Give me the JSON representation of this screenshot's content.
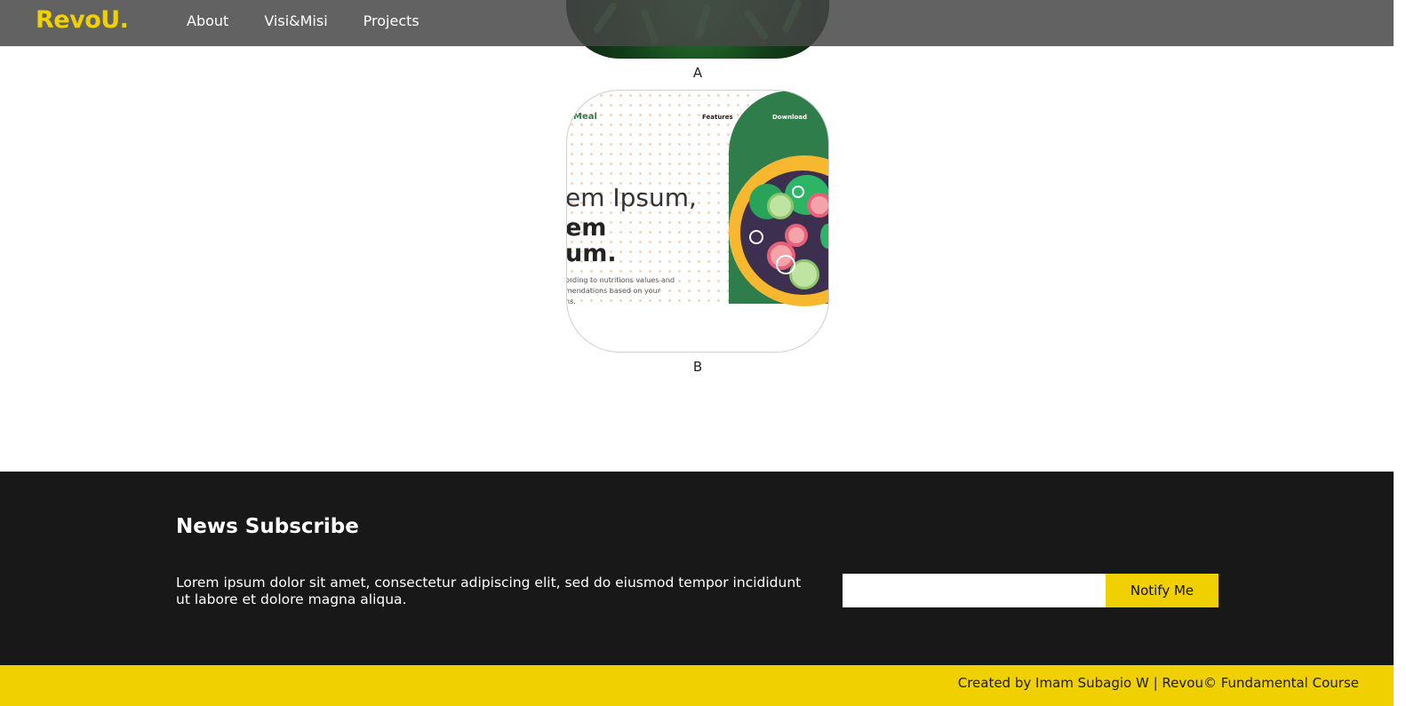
{
  "nav": {
    "brand": "RevoU.",
    "links": [
      {
        "label": "About"
      },
      {
        "label": "Visi&Misi"
      },
      {
        "label": "Projects"
      }
    ]
  },
  "projects": [
    {
      "caption": "A",
      "image": "green-leaves-photo"
    },
    {
      "caption": "B",
      "image": "meal-app-mockup",
      "mockup": {
        "brand": "Meal",
        "nav_features": "Features",
        "nav_download": "Download",
        "heading_1": "em Ipsum,",
        "heading_2_line1": "em",
        "heading_2_line2": "um.",
        "para_line1": "ording to nutritions values and",
        "para_line2": "mendations based on your",
        "para_line3": "ns."
      }
    }
  ],
  "subscribe": {
    "title": "News Subscribe",
    "text": "Lorem ipsum dolor sit amet, consectetur adipiscing elit, sed do eiusmod tempor incididunt ut labore et dolore magna aliqua.",
    "email_value": "",
    "button_label": "Notify Me"
  },
  "footer": {
    "credit": "Created by Imam Subagio W | Revou© Fundamental Course"
  },
  "colors": {
    "brand_yellow": "#f0d000",
    "footer_dark": "#181818",
    "nav_bg": "#5a5a5a"
  }
}
